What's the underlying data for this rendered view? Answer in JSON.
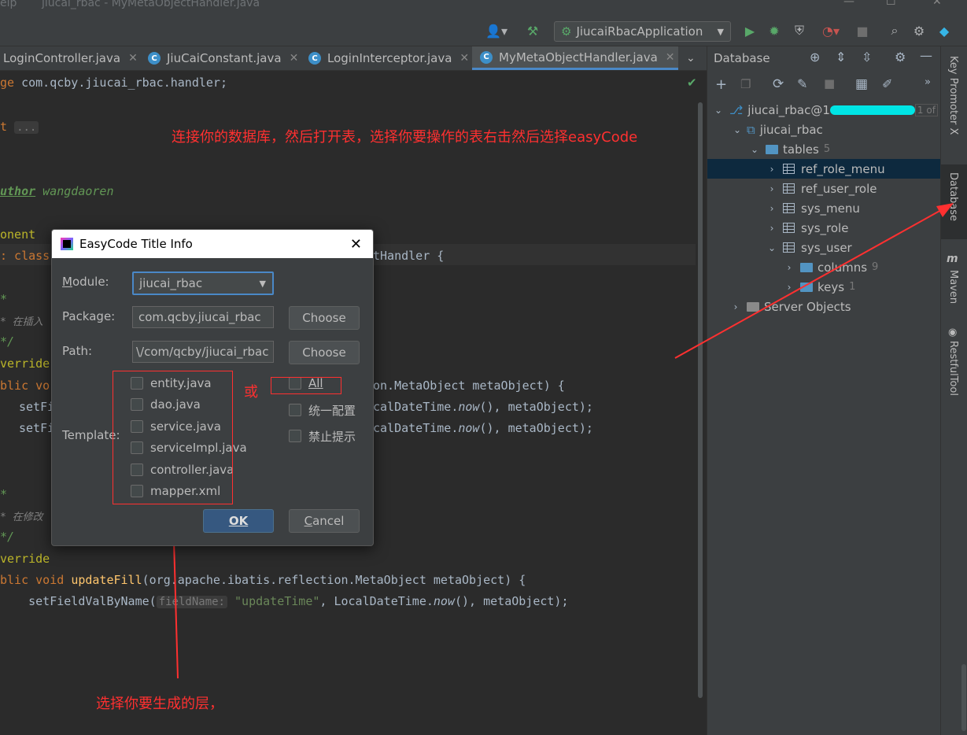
{
  "window": {
    "menu_fragment": "elp",
    "title": "jiucai_rbac - MyMetaObjectHandler.java"
  },
  "toolbar": {
    "run_config": "JiucaiRbacApplication"
  },
  "tabs": [
    {
      "label": "LoginController.java",
      "active": false
    },
    {
      "label": "JiuCaiConstant.java",
      "active": false
    },
    {
      "label": "LoginInterceptor.java",
      "active": false
    },
    {
      "label": "MyMetaObjectHandler.java",
      "active": true
    }
  ],
  "editor": {
    "line1_kw": "ge",
    "line1_pkg": " com.qcby.jiucai_rbac.handler;",
    "line2_kw": "t",
    "line2_fold": "...",
    "author_tag": "uthor",
    "author_name": " wangdaoren",
    "component": "onent",
    "class_kw": ": class",
    "class_tail": "tHandler {",
    "cm_open1": "*",
    "cm_insert": "* 在插入",
    "cm_close1": "*/",
    "override1": "verride",
    "public1": "blic vo",
    "sig1_tail": "on.MetaObject metaObject) {",
    "setf1": "setFi",
    "setf1_tail_a": "calDateTime.",
    "setf1_now": "now",
    "setf1_tail_b": "(), metaObject);",
    "setf2": "setFi",
    "setf2_tail_a": "calDateTime.",
    "setf2_now": "now",
    "setf2_tail_b": "(), metaObject);",
    "cm_open2": "*",
    "cm_update": "* 在修改",
    "cm_close2": "*/",
    "override2": "verride",
    "public2_a": "blic void ",
    "public2_fn": "updateFill",
    "public2_b": "(org.apache.ibatis.reflection.MetaObject metaObject) {",
    "setf3_a": "    setFieldValByName(",
    "setf3_hint": "fieldName:",
    "setf3_str": " \"updateTime\"",
    "setf3_b": ", LocalDateTime.",
    "setf3_now": "now",
    "setf3_c": "(), metaObject);"
  },
  "annotations": {
    "top": "连接你的数据库，然后打开表，选择你要操作的表右击然后选择easyCode",
    "or": "或",
    "bottom": "选择你要生成的层，"
  },
  "database_panel": {
    "title": "Database",
    "tree": [
      {
        "label": "jiucai_rbac@1",
        "level": 0,
        "expanded": true,
        "kind": "datasource"
      },
      {
        "label": "jiucai_rbac",
        "level": 1,
        "expanded": true,
        "kind": "schema"
      },
      {
        "label": "tables",
        "count": "5",
        "level": 2,
        "expanded": true,
        "kind": "folder"
      },
      {
        "label": "ref_role_menu",
        "level": 3,
        "expanded": false,
        "kind": "table",
        "selected": true
      },
      {
        "label": "ref_user_role",
        "level": 3,
        "expanded": false,
        "kind": "table"
      },
      {
        "label": "sys_menu",
        "level": 3,
        "expanded": false,
        "kind": "table"
      },
      {
        "label": "sys_role",
        "level": 3,
        "expanded": false,
        "kind": "table"
      },
      {
        "label": "sys_user",
        "level": 3,
        "expanded": true,
        "kind": "table"
      },
      {
        "label": "columns",
        "count": "9",
        "level": 4,
        "expanded": false,
        "kind": "folder"
      },
      {
        "label": "keys",
        "count": "1",
        "level": 4,
        "expanded": false,
        "kind": "folder"
      },
      {
        "label": "Server Objects",
        "level": 1,
        "expanded": false,
        "kind": "folder"
      }
    ],
    "truncated_badge": "1 of"
  },
  "side_tools": {
    "key_promoter": "Key Promoter X",
    "database": "Database",
    "maven": "Maven",
    "restful": "RestfulTool"
  },
  "dialog": {
    "title": "EasyCode Title Info",
    "module_label": "Module:",
    "module_value": "jiucai_rbac",
    "package_label": "Package:",
    "package_value": "com.qcby.jiucai_rbac",
    "path_label": "Path:",
    "path_value": "\\/com/qcby/jiucai_rbac",
    "choose1": "Choose",
    "choose2": "Choose",
    "template_label": "Template:",
    "templates": [
      "entity.java",
      "dao.java",
      "service.java",
      "serviceImpl.java",
      "controller.java",
      "mapper.xml"
    ],
    "all_label": "All",
    "unified_config": "统一配置",
    "no_prompt": "禁止提示",
    "ok": "OK",
    "cancel": "Cancel"
  },
  "colors": {
    "annotation_red": "#ff3030",
    "selection": "#0d293e",
    "primary_button": "#365880"
  }
}
